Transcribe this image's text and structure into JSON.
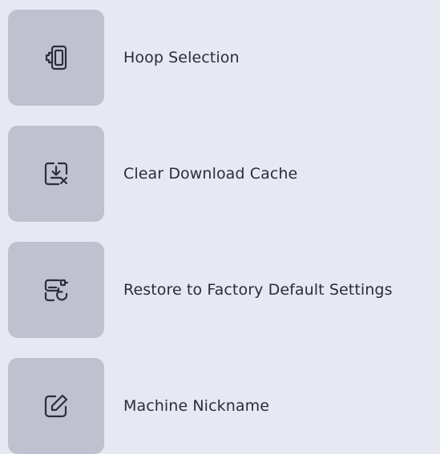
{
  "menu": {
    "items": [
      {
        "label": "Hoop Selection",
        "icon": "hoop-icon"
      },
      {
        "label": "Clear Download Cache",
        "icon": "clear-download-cache-icon"
      },
      {
        "label": "Restore to Factory Default Settings",
        "icon": "restore-factory-icon"
      },
      {
        "label": "Machine Nickname",
        "icon": "edit-pencil-icon"
      }
    ]
  },
  "colors": {
    "background": "#e6e8f2",
    "tile": "#bfc1cf",
    "icon_stroke": "#2b2d3a",
    "text": "#2b2d3a"
  }
}
